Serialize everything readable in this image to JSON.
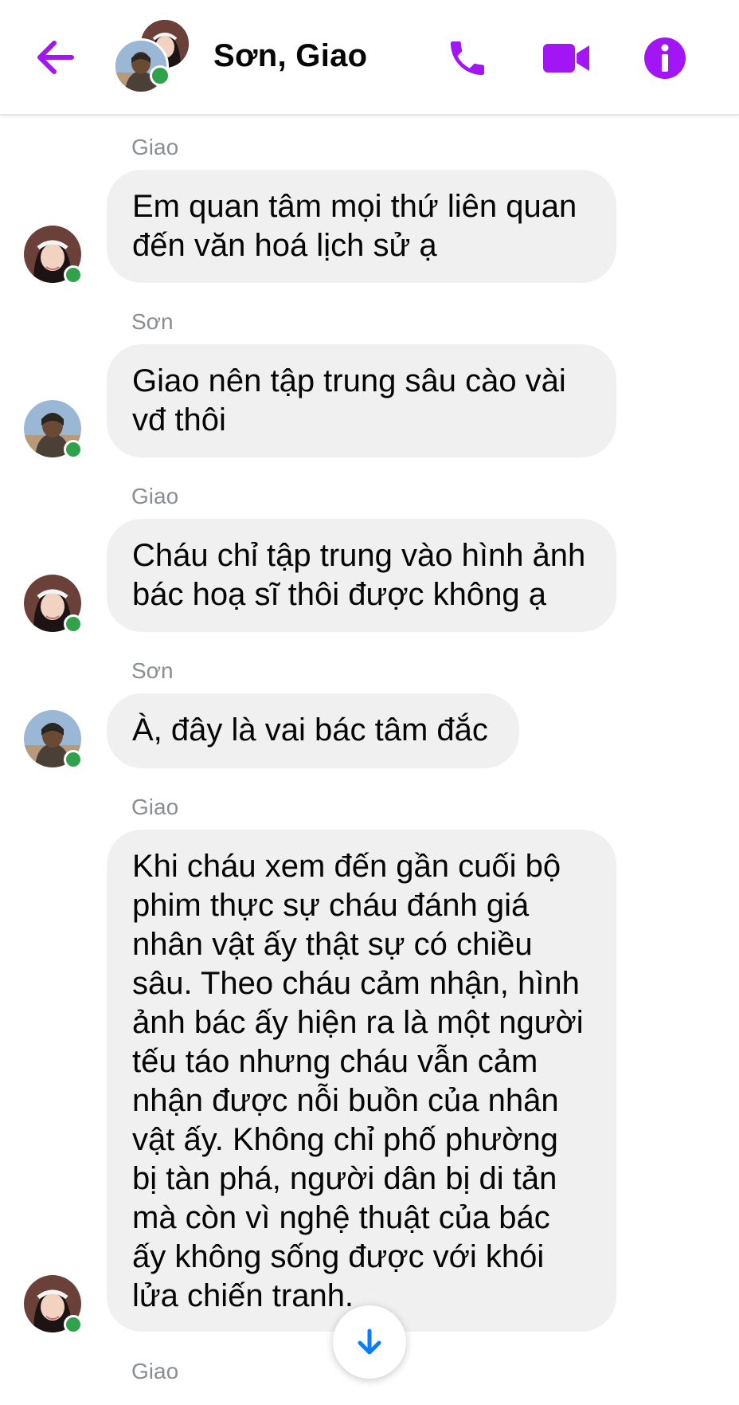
{
  "header": {
    "title": "Sơn, Giao",
    "accent_color": "#a216f5",
    "icons": [
      "back-arrow-icon",
      "phone-icon",
      "video-camera-icon",
      "info-icon"
    ]
  },
  "messages": [
    {
      "sender": "Giao",
      "text_lines": [
        "Em quan tâm mọi thứ liên quan",
        "đến văn hoá lịch sử ạ"
      ]
    },
    {
      "sender": "Sơn",
      "text_lines": [
        "Giao nên tập trung sâu cào vài",
        "vđ thôi"
      ]
    },
    {
      "sender": "Giao",
      "text_lines": [
        "Cháu chỉ tập trung vào hình ảnh",
        "bác hoạ sĩ thôi được không ạ"
      ]
    },
    {
      "sender": "Sơn",
      "text_lines": [
        "À, đây là vai bác tâm đắc"
      ]
    },
    {
      "sender": "Giao",
      "text_lines": [
        "Khi cháu xem đến gần cuối bộ",
        "phim thực sự cháu đánh giá",
        "nhân vật ấy thật sự có chiều",
        "sâu. Theo cháu cảm nhận, hình",
        "ảnh bác ấy hiện ra là một người",
        "tếu táo nhưng cháu vẫn cảm",
        "nhận được nỗi buồn của nhân",
        "vật ấy. Không chỉ phố phường",
        "bị tàn phá, người dân bị di tản",
        "mà còn vì nghệ thuật của bác",
        "ấy không sống được với khói",
        "lửa chiến tranh."
      ]
    },
    {
      "sender": "Giao",
      "text_lines": []
    }
  ],
  "scroll_button_icon": "arrow-down-icon"
}
